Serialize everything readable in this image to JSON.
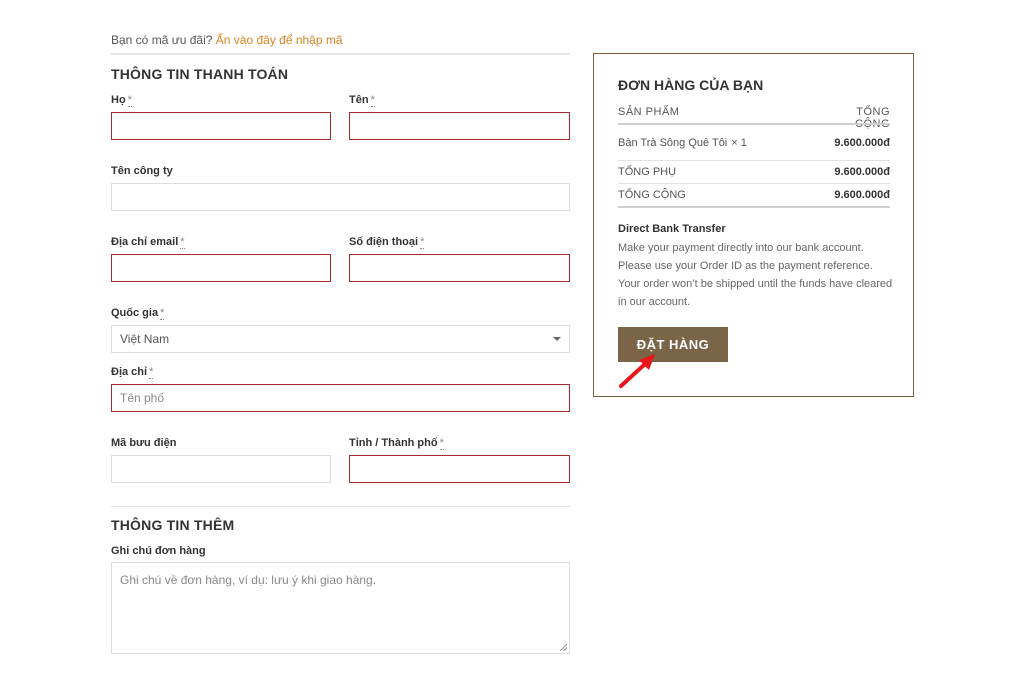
{
  "coupon": {
    "text": "Bạn có mã ưu đãi?",
    "link": "Ấn vào đây để nhập mã"
  },
  "billing": {
    "title": "THÔNG TIN THANH TOÁN",
    "required_mark": "*",
    "last_name_label": "Họ",
    "first_name_label": "Tên",
    "company_label": "Tên công ty",
    "email_label": "Địa chỉ email",
    "phone_label": "Số điện thoại",
    "country_label": "Quốc gia",
    "country_value": "Việt Nam",
    "address_label": "Địa chỉ",
    "address_placeholder": "Tên phố",
    "postcode_label": "Mã bưu điện",
    "city_label": "Tỉnh / Thành phố"
  },
  "additional": {
    "title": "THÔNG TIN THÊM",
    "notes_label": "Ghi chú đơn hàng",
    "notes_placeholder": "Ghi chú về đơn hàng, ví dụ: lưu ý khi giao hàng."
  },
  "order": {
    "title": "ĐƠN HÀNG CỦA BẠN",
    "col_product": "SẢN PHẨM",
    "col_total": "TỔNG CỘNG",
    "item_name": "Bàn Trà Sông Quê Tôi",
    "item_qty": "× 1",
    "item_price": "9.600.000đ",
    "subtotal_label": "TỔNG PHỤ",
    "subtotal_value": "9.600.000đ",
    "total_label": "TỔNG CỘNG",
    "total_value": "9.600.000đ",
    "payment_title": "Direct Bank Transfer",
    "payment_text": "Make your payment directly into our bank account. Please use your Order ID as the payment reference. Your order won’t be shipped until the funds have cleared in our account.",
    "place_order": "ĐẶT HÀNG"
  },
  "colors": {
    "accent_link": "#d9831f",
    "button": "#7a6548",
    "error_border": "#a52a2a",
    "annotation_arrow": "#e8151b"
  }
}
